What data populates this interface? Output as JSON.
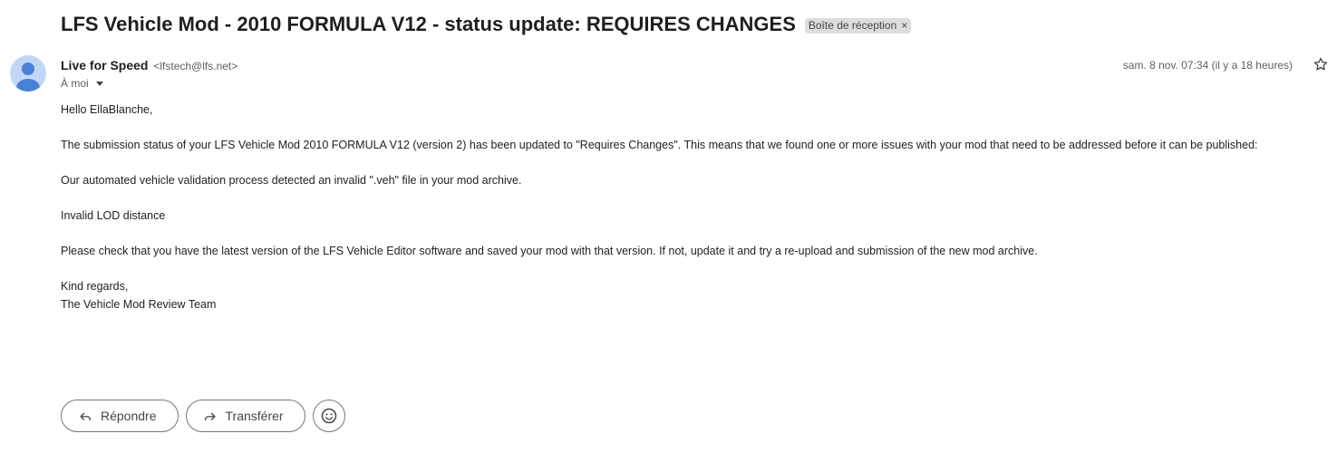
{
  "subject": {
    "title": "LFS Vehicle Mod - 2010 FORMULA V12 - status update: REQUIRES CHANGES",
    "label": "Boîte de réception",
    "label_remove": "×"
  },
  "message": {
    "sender_name": "Live for Speed",
    "sender_email": "<lfstech@lfs.net>",
    "recipient": "À moi",
    "date": "sam. 8 nov. 07:34 (il y a 18 heures)",
    "avatar_icon": "person-icon",
    "star_icon": "star-outline-icon",
    "body": {
      "greeting": "Hello EllaBlanche,",
      "para1": "The submission status of your LFS Vehicle Mod 2010 FORMULA V12 (version 2) has been updated to \"Requires Changes\". This means that we found one or more issues with your mod that need to be addressed before it can be published:",
      "para2": "Our automated vehicle validation process detected an invalid \".veh\" file in your mod archive.",
      "para3": "Invalid LOD distance",
      "para4": "Please check that you have the latest version of the LFS Vehicle Editor software and saved your mod with that version. If not, update it and try a re-upload and submission of the new mod archive.",
      "closing": "Kind regards,",
      "signature": "The Vehicle Mod Review Team"
    }
  },
  "actions": {
    "reply_label": "Répondre",
    "forward_label": "Transférer",
    "reply_icon": "reply-icon",
    "forward_icon": "forward-icon",
    "emoji_icon": "emoji-icon"
  },
  "colors": {
    "avatar_bg": "#c2d7f7",
    "avatar_fg": "#4a7fd6",
    "chip_bg": "#dddddd",
    "button_border": "#747775"
  }
}
